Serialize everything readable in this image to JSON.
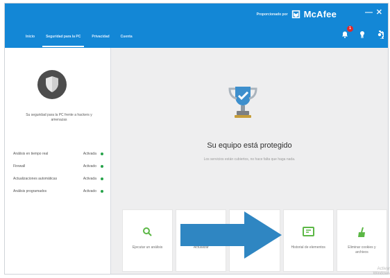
{
  "window": {
    "brand_prefix": "Proporcionado por",
    "brand_name": "McAfee",
    "minimize": "—",
    "close": "✕"
  },
  "nav": {
    "tabs": [
      {
        "label": "Inicio",
        "active": false
      },
      {
        "label": "Seguridad para la PC",
        "active": true
      },
      {
        "label": "Privacidad",
        "active": false
      },
      {
        "label": "Cuenta",
        "active": false
      }
    ]
  },
  "header_icons": {
    "notifications_count": "1"
  },
  "sidebar": {
    "message": "Su seguridad para la PC frente a hackers y amenazas",
    "items": [
      {
        "label": "Análisis en tiempo real",
        "status": "Activada"
      },
      {
        "label": "Firewall",
        "status": "Activado"
      },
      {
        "label": "Actualizaciones automáticas",
        "status": "Activada"
      },
      {
        "label": "Análisis programados",
        "status": "Activado"
      }
    ]
  },
  "main": {
    "title": "Su equipo está protegido",
    "subtitle": "Los servicios están cubiertos, no hace falta que haga nada.",
    "cards": [
      {
        "label": "Ejecutar un análisis",
        "icon": "search-icon"
      },
      {
        "label": "Actualizar",
        "icon": "update-icon"
      },
      {
        "label": "",
        "icon": "blank"
      },
      {
        "label": "Historial de elementos",
        "icon": "history-icon"
      },
      {
        "label": "Eliminar cookies y archivos",
        "icon": "broom-icon"
      }
    ]
  },
  "overlay": {
    "watermark": "Activar Windows"
  },
  "colors": {
    "brand_blue": "#1387d6",
    "arrow_blue": "#2f86c2",
    "active_green": "#26a34a"
  }
}
